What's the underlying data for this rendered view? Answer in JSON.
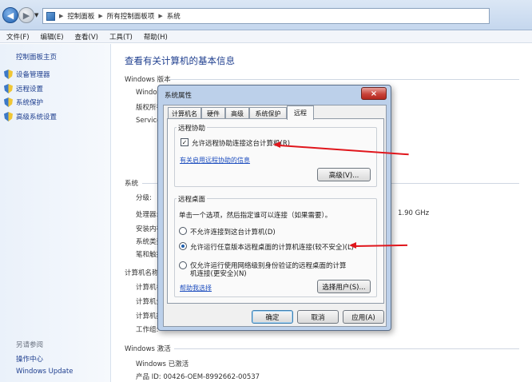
{
  "address": {
    "crumbs": [
      "控制面板",
      "所有控制面板项",
      "系统"
    ]
  },
  "menu": [
    "文件(F)",
    "编辑(E)",
    "查看(V)",
    "工具(T)",
    "帮助(H)"
  ],
  "sidebar": {
    "home": "控制面板主页",
    "items": [
      "设备管理器",
      "远程设置",
      "系统保护",
      "高级系统设置"
    ],
    "see_also_title": "另请参阅",
    "see_also": [
      "操作中心",
      "Windows Update"
    ]
  },
  "main": {
    "title": "查看有关计算机的基本信息",
    "edition_heading": "Windows 版本",
    "edition_rows": [
      "Window",
      "版权所有",
      "Service"
    ],
    "system_heading": "系统",
    "system_rows": [
      "分级:",
      "处理器:",
      "安装内存",
      "系统类型",
      "笔和触摸"
    ],
    "cpu_freq": "1.90 GHz",
    "computer_heading": "计算机名称,",
    "computer_rows": [
      "计算机名",
      "计算机全",
      "计算机描",
      "工作组:"
    ],
    "activation_heading": "Windows 激活",
    "activated": "Windows 已激活",
    "product_id": "产品 ID: 00426-OEM-8992662-00537"
  },
  "dialog": {
    "title": "系统属性",
    "close": "×",
    "tabs": [
      "计算机名",
      "硬件",
      "高级",
      "系统保护",
      "远程"
    ],
    "active_tab": "远程",
    "assistance": {
      "heading": "远程协助",
      "checkbox_label": "允许远程协助连接这台计算机(R)",
      "checked": true,
      "link": "有关启用远程协助的信息",
      "advanced_button": "高级(V)..."
    },
    "desktop": {
      "heading": "远程桌面",
      "instruction": "单击一个选项，然后指定谁可以连接（如果需要）。",
      "option1": "不允许连接到这台计算机(D)",
      "option2": "允许运行任意版本远程桌面的计算机连接(较不安全)(L)",
      "option3_line1": "仅允许运行使用网络级别身份验证的远程桌面的计算",
      "option3_line2": "机连接(更安全)(N)",
      "selected": "option2",
      "help_link": "帮助我选择",
      "select_users_button": "选择用户(S)..."
    },
    "buttons": {
      "ok": "确定",
      "cancel": "取消",
      "apply": "应用(A)"
    }
  },
  "colors": {
    "annotation_arrow": "#e0161c",
    "link": "#1f3f8f"
  }
}
